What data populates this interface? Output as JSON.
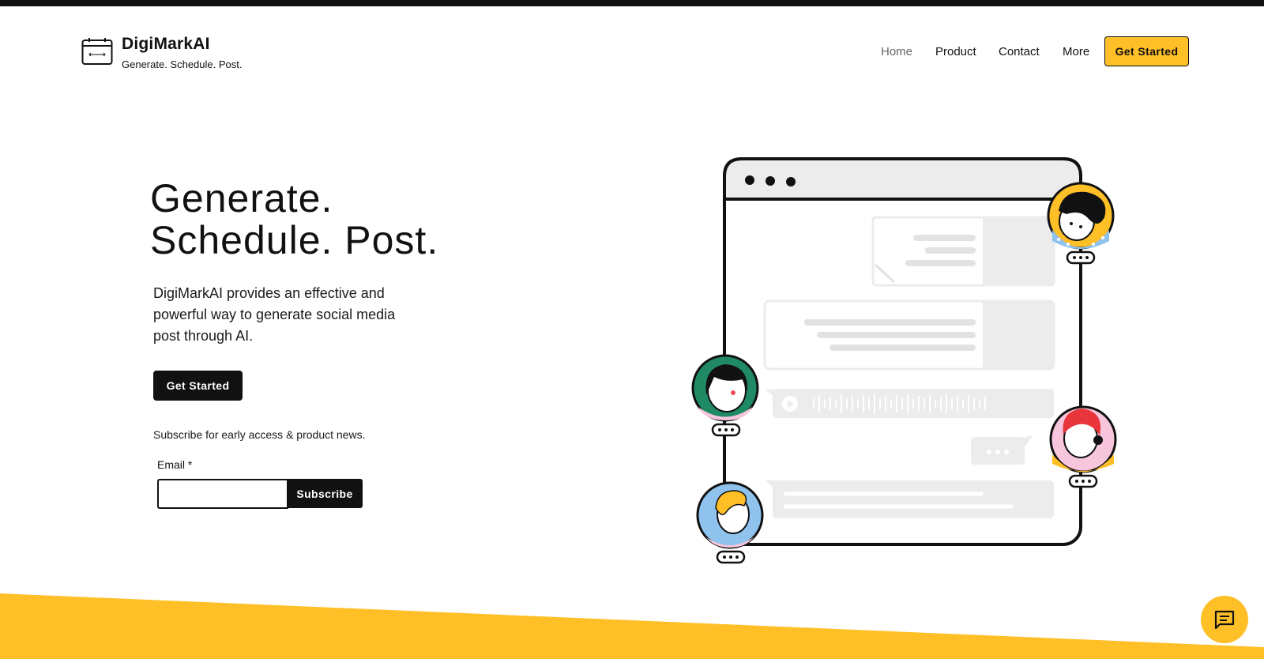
{
  "header": {
    "brand_name": "DigiMarkAI",
    "brand_tagline": "Generate. Schedule. Post.",
    "nav": [
      {
        "label": "Home",
        "active": true
      },
      {
        "label": "Product",
        "active": false
      },
      {
        "label": "Contact",
        "active": false
      },
      {
        "label": "More",
        "active": false
      }
    ],
    "cta_label": "Get Started"
  },
  "hero": {
    "title_line1": "Generate.",
    "title_line2": "Schedule. Post.",
    "description": "DigiMarkAI provides an effective and powerful way to generate social media post through AI.",
    "cta_label": "Get Started",
    "subscribe_text": "Subscribe for early access & product news.",
    "email_label": "Email *",
    "email_value": "",
    "subscribe_label": "Subscribe"
  },
  "icons": {
    "logo": "calendar-logo-icon",
    "chat": "chat-icon",
    "play": "play-icon",
    "typing": "typing-dots-icon"
  },
  "colors": {
    "accent": "#ffbf27",
    "dark": "#111111",
    "active_nav": "#666666",
    "placeholder_gray": "#ececec"
  }
}
